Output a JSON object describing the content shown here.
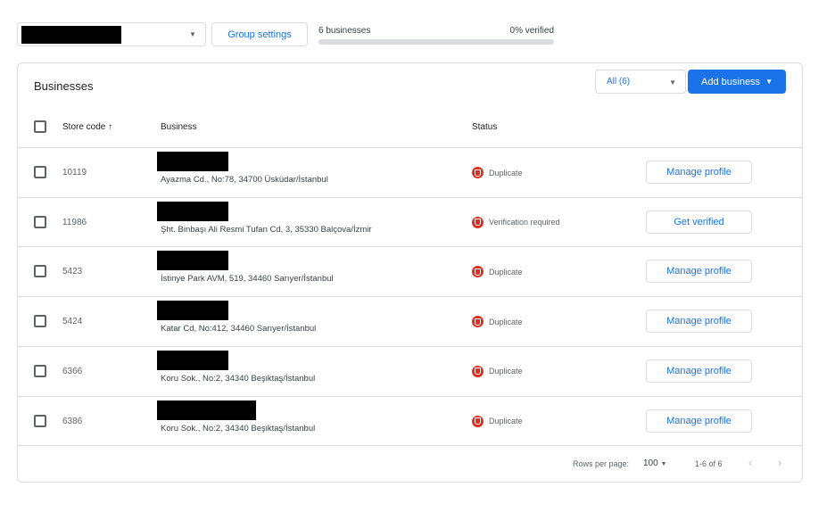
{
  "top": {
    "group_settings": "Group settings",
    "count_label": "6 businesses",
    "verified_label": "0% verified",
    "verified_fraction": 0
  },
  "card": {
    "title": "Businesses",
    "filter": "All (6)",
    "add_business": "Add business"
  },
  "columns": {
    "store_code": "Store code",
    "business": "Business",
    "status": "Status"
  },
  "rows": [
    {
      "code": "10119",
      "address": "Ayazma Cd., No:78, 34700 Üsküdar/İstanbul",
      "status": "Duplicate",
      "action": "Manage profile"
    },
    {
      "code": "11986",
      "address": "Şht. Binbaşı Ali Resmi Tufan Cd, 3, 35330 Balçova/İzmir",
      "status": "Verification required",
      "action": "Get verified"
    },
    {
      "code": "5423",
      "address": "İstinye Park AVM, 519, 34460 Sarıyer/İstanbul",
      "status": "Duplicate",
      "action": "Manage profile"
    },
    {
      "code": "5424",
      "address": "Katar Cd, No:412, 34460 Sarıyer/İstanbul",
      "status": "Duplicate",
      "action": "Manage profile"
    },
    {
      "code": "6366",
      "address": "Koru Sok., No:2, 34340 Beşiktaş/İstanbul",
      "status": "Duplicate",
      "action": "Manage profile"
    },
    {
      "code": "6386",
      "address": "Koru Sok., No:2, 34340 Beşiktaş/İstanbul",
      "status": "Duplicate",
      "action": "Manage profile"
    }
  ],
  "footer": {
    "rows_per_page_label": "Rows per page:",
    "rows_per_page": "100",
    "range": "1-6 of 6"
  }
}
